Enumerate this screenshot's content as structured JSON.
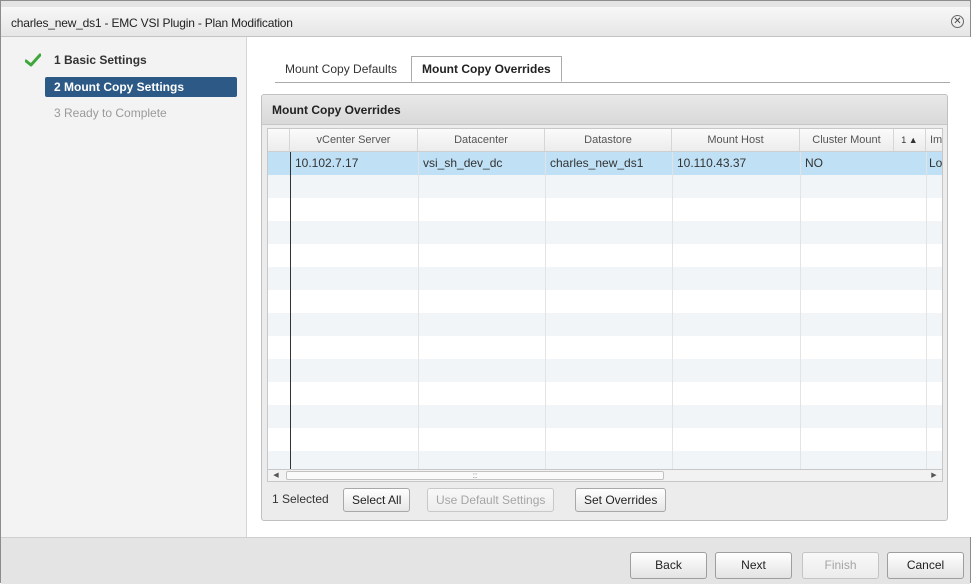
{
  "window": {
    "title": "charles_new_ds1 - EMC VSI Plugin - Plan Modification",
    "close_glyph": "✕"
  },
  "steps": [
    {
      "label": "1  Basic Settings",
      "state": "done",
      "icon": "checkmark-icon"
    },
    {
      "label": "2  Mount Copy Settings",
      "state": "active"
    },
    {
      "label": "3  Ready to Complete",
      "state": "future"
    }
  ],
  "tabs": [
    {
      "label": "Mount Copy Defaults",
      "active": false
    },
    {
      "label": "Mount Copy Overrides",
      "active": true
    }
  ],
  "panel": {
    "title": "Mount Copy Overrides"
  },
  "table": {
    "columns": [
      "vCenter Server",
      "Datacenter",
      "Datastore",
      "Mount Host",
      "Cluster Mount",
      "1 ▲",
      "Im"
    ],
    "rows": [
      {
        "selected": true,
        "cells": [
          "10.102.7.17",
          "vsi_sh_dev_dc",
          "charles_new_ds1",
          "10.110.43.37",
          "NO",
          "Log"
        ]
      }
    ],
    "scroll_grip": "::"
  },
  "grid_footer": {
    "selected_count": "1 Selected",
    "select_all": "Select All",
    "use_defaults": "Use Default Settings",
    "set_overrides": "Set Overrides"
  },
  "footer": {
    "back": "Back",
    "next": "Next",
    "finish": "Finish",
    "cancel": "Cancel"
  },
  "colors": {
    "active_step_bg": "#2c5985",
    "selected_row": "#bfe0f5",
    "check_green": "#3ea63a"
  }
}
